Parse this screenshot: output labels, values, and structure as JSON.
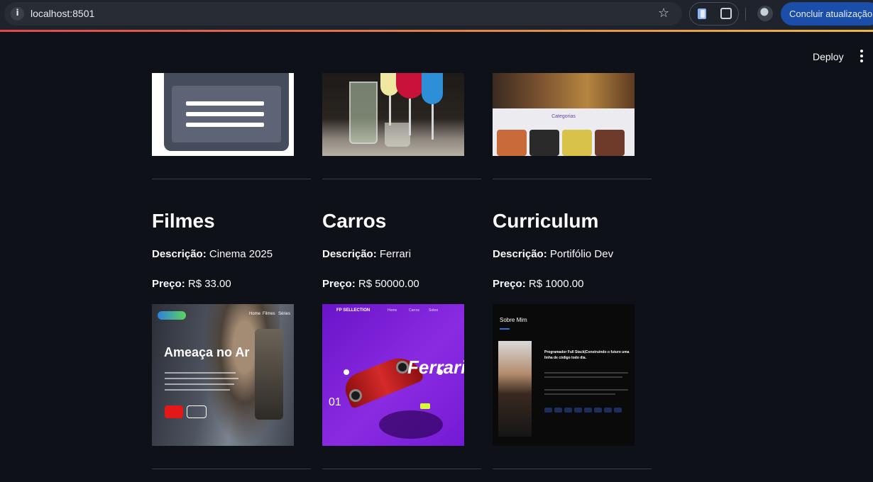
{
  "browser": {
    "url": "localhost:8501",
    "update_label": "Concluir atualização",
    "icons": [
      "info-icon",
      "star-icon",
      "extension-icon",
      "puzzle-icon",
      "profile-avatar",
      "menu-icon"
    ]
  },
  "app": {
    "deploy_label": "Deploy",
    "menu_icon": "kebab-icon"
  },
  "products": [
    {
      "title": "Filmes",
      "desc_label": "Descrição:",
      "desc_value": "Cinema 2025",
      "price_label": "Preço:",
      "price_value": "R$ 33.00",
      "movie_title": "Ameaça no Ar",
      "movie_nav": [
        "Home",
        "Filmes",
        "Séries"
      ]
    },
    {
      "title": "Carros",
      "desc_label": "Descrição:",
      "desc_value": "Ferrari",
      "price_label": "Preço:",
      "price_value": "R$ 50000.00",
      "car_brand": "FP SELLECTION",
      "car_title": "Ferrari",
      "car_number": "01"
    },
    {
      "title": "Curriculum",
      "desc_label": "Descrição:",
      "desc_value": "Portifólio Dev",
      "price_label": "Preço:",
      "price_value": "R$ 1000.00",
      "cv_title": "Sobre Mim",
      "cv_headline": "Programador Full Stack|Construindo o futuro uma linha de código todo dia.",
      "top_section_label": "Categorias"
    }
  ]
}
